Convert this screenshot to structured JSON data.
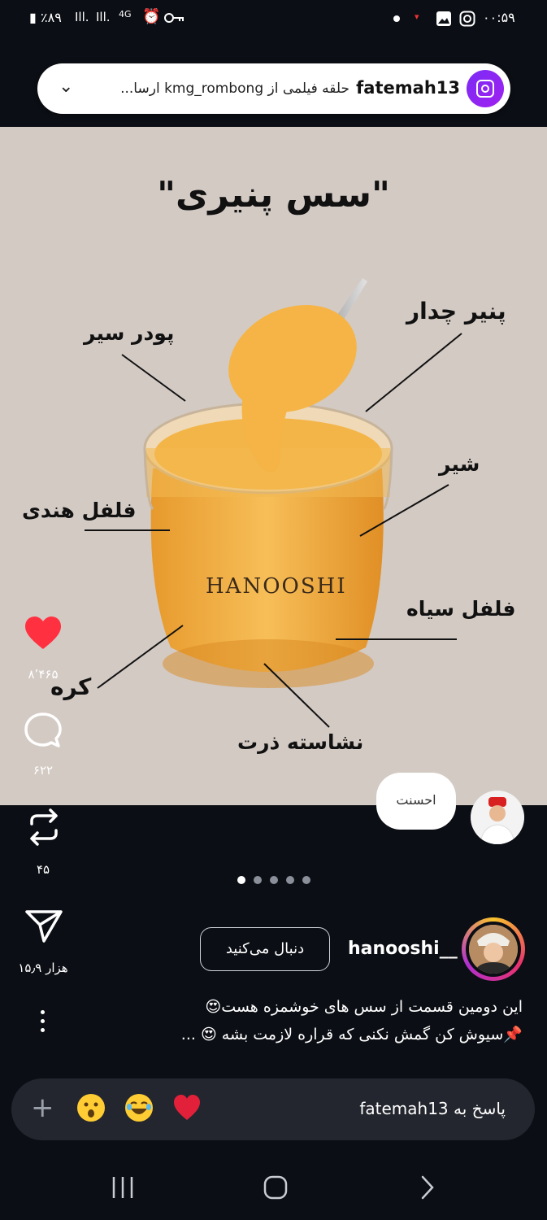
{
  "status_bar": {
    "time": "۰۰:۵۹",
    "battery": "٪۸۹",
    "network": "4G"
  },
  "notification": {
    "username": "fatemah13",
    "message": "حلقه فیلمی از kmg_rombong ارسا...",
    "icon": "instagram-icon",
    "accent": "#7b2cf5"
  },
  "post": {
    "title": "\"سس پنیری\"",
    "brand": "HANOOSHI",
    "ingredients": {
      "garlic_powder": "پودر سیر",
      "cheddar": "پنیر چدار",
      "milk": "شیر",
      "cayenne": "فلفل هندی",
      "black_pepper": "فلفل سیاه",
      "butter": "کره",
      "cornstarch": "نشاسته ذرت"
    },
    "background": "#d3cac4",
    "sauce_color": "#f2a93c"
  },
  "actions": {
    "likes": "۸٬۴۶۵",
    "comments": "۶۲۲",
    "reposts": "۴۵",
    "shares": "۱۵٫۹ هزار",
    "like_color": "#ff3040"
  },
  "comment_preview": {
    "text": "احسنت"
  },
  "author": {
    "username": "hanooshi__",
    "follow_label": "دنبال می‌کنید"
  },
  "caption": {
    "line1": "این دومین قسمت از سس های خوشمزه هست😍",
    "line2": "📌سیوش کن گمش نکنی که قراره لازمت بشه 😍 ..."
  },
  "reply": {
    "placeholder": "پاسخ به fatemah13",
    "quick_reactions": [
      "heart",
      "laughing",
      "surprised"
    ]
  }
}
